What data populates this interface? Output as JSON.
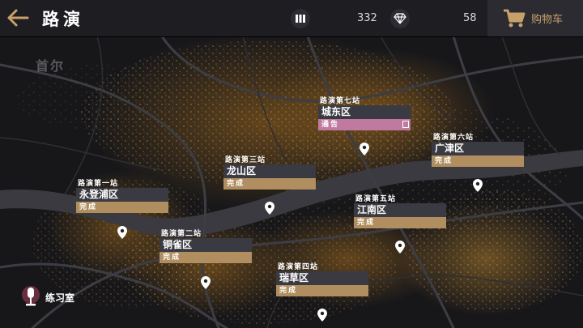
{
  "header": {
    "title": "路演",
    "currency1_value": "332",
    "currency2_value": "58",
    "cart_label": "购物车"
  },
  "map": {
    "city_label": "首尔"
  },
  "stops": [
    {
      "header": "路演第一站",
      "name": "永登浦区",
      "status": "完成",
      "status_type": "done"
    },
    {
      "header": "路演第二站",
      "name": "铜雀区",
      "status": "完成",
      "status_type": "done"
    },
    {
      "header": "路演第三站",
      "name": "龙山区",
      "status": "完成",
      "status_type": "done"
    },
    {
      "header": "路演第四站",
      "name": "瑞草区",
      "status": "完成",
      "status_type": "done"
    },
    {
      "header": "路演第五站",
      "name": "江南区",
      "status": "完成",
      "status_type": "done"
    },
    {
      "header": "路演第六站",
      "name": "广津区",
      "status": "完成",
      "status_type": "done"
    },
    {
      "header": "路演第七站",
      "name": "城东区",
      "status": "通告",
      "status_type": "notice"
    }
  ],
  "practice": {
    "label": "练习室"
  },
  "colors": {
    "accent_gold": "#b08e5f",
    "notice_pink": "#c07aa0",
    "cart_text": "#c8a06a"
  }
}
